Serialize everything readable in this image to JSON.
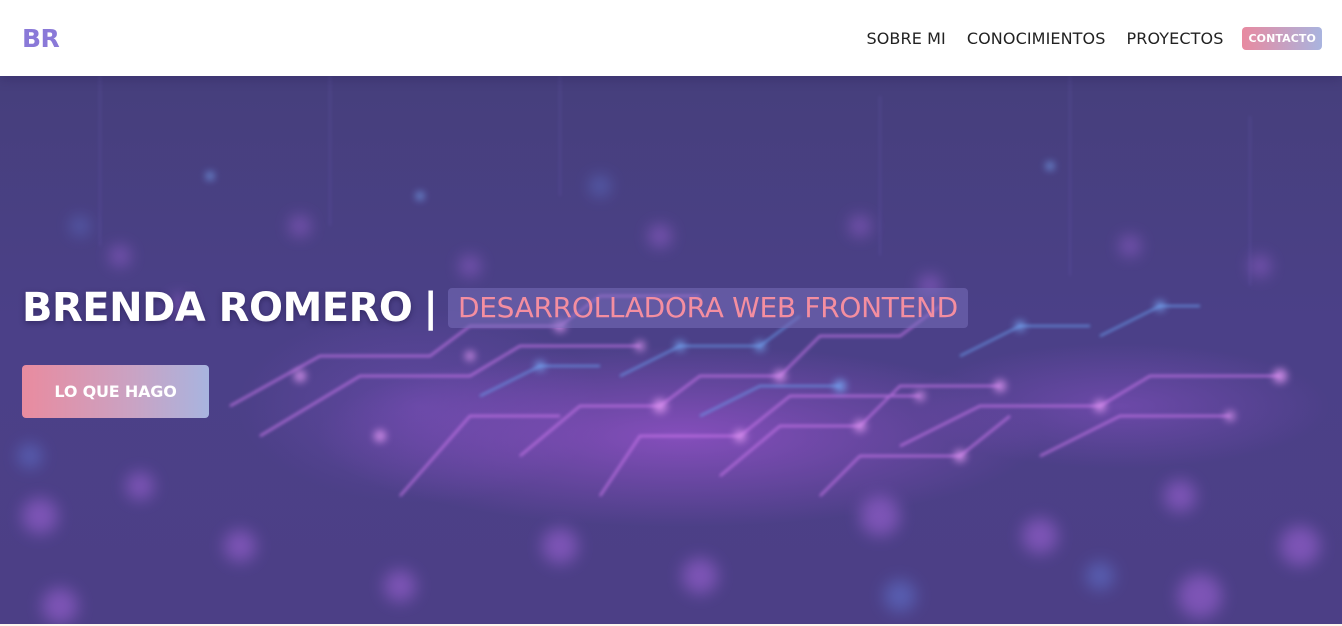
{
  "nav": {
    "logo": "BR",
    "links": [
      "SOBRE MI",
      "CONOCIMIENTOS",
      "PROYECTOS"
    ],
    "cta": "CONTACTO"
  },
  "hero": {
    "name": "BRENDA ROMERO",
    "separator": "|",
    "role": "DESARROLLADORA WEB FRONTEND",
    "button": "LO QUE HAGO"
  },
  "colors": {
    "logo": "#8a79d8",
    "hero_background": "#4b4088",
    "role_text": "#f48ea0",
    "gradient_start": "#e98b9f",
    "gradient_end": "#a8b4df"
  }
}
